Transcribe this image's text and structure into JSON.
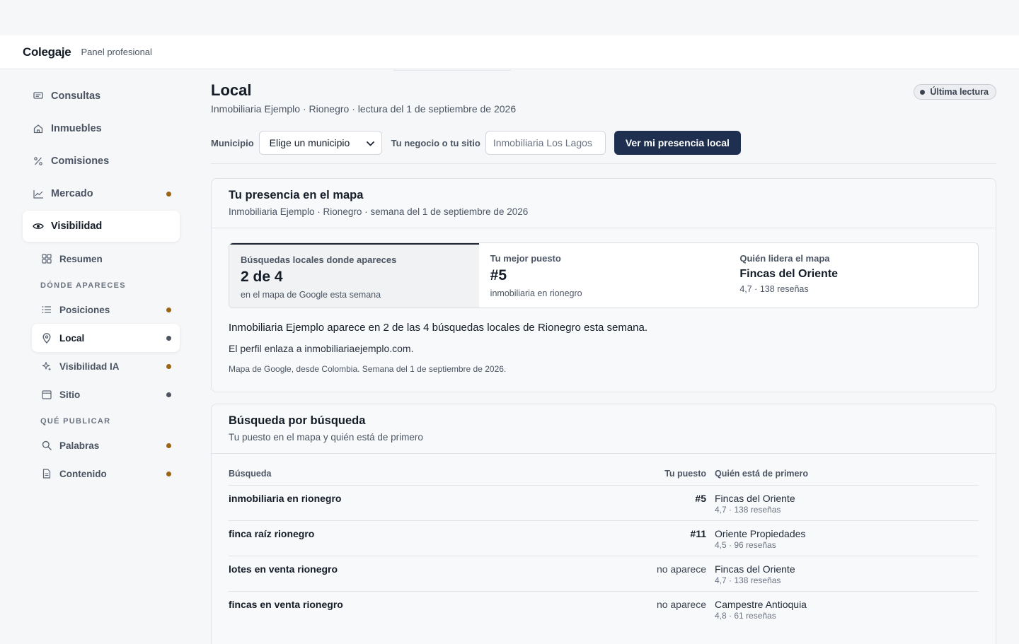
{
  "app": {
    "brand": "Colegaje",
    "subtitle": "Panel profesional"
  },
  "sidebar": {
    "items": [
      {
        "label": "Consultas",
        "icon": "message-icon"
      },
      {
        "label": "Inmuebles",
        "icon": "home-icon"
      },
      {
        "label": "Comisiones",
        "icon": "percent-icon"
      },
      {
        "label": "Mercado",
        "icon": "chart-line-icon",
        "dot": "amber"
      },
      {
        "label": "Visibilidad",
        "icon": "eye-icon",
        "active": true
      }
    ],
    "resumen": "Resumen",
    "section1": "DÓNDE APARECES",
    "section1_items": [
      {
        "label": "Posiciones",
        "dot": "amber"
      },
      {
        "label": "Local",
        "dot": "gray",
        "active": true
      },
      {
        "label": "Visibilidad IA",
        "dot": "amber"
      },
      {
        "label": "Sitio",
        "dot": "gray"
      }
    ],
    "section2": "QUÉ PUBLICAR",
    "section2_items": [
      {
        "label": "Palabras",
        "dot": "amber"
      },
      {
        "label": "Contenido",
        "dot": "amber"
      }
    ]
  },
  "header": {
    "title": "Local",
    "subtitle": "Inmobiliaria Ejemplo · Rionegro · lectura del 1 de septiembre de 2026",
    "badge": "Última lectura"
  },
  "filters": {
    "municipio_label": "Municipio",
    "municipio_value": "Elige un municipio",
    "negocio_label": "Tu negocio o tu sitio",
    "negocio_placeholder": "Inmobiliaria Los Lagos",
    "submit": "Ver mi presencia local"
  },
  "presence": {
    "title": "Tu presencia en el mapa",
    "subtitle": "Inmobiliaria Ejemplo · Rionegro · semana del 1 de septiembre de 2026",
    "stats": [
      {
        "label": "Búsquedas locales donde apareces",
        "value": "2 de 4",
        "note": "en el mapa de Google esta semana"
      },
      {
        "label": "Tu mejor puesto",
        "value": "#5",
        "note": "inmobiliaria en rionegro"
      },
      {
        "label": "Quién lidera el mapa",
        "value": "Fincas del Oriente",
        "note": "4,7 · 138 reseñas"
      }
    ],
    "summary": "Inmobiliaria Ejemplo aparece en 2 de las 4 búsquedas locales de Rionegro esta semana.",
    "link_note": "El perfil enlaza a inmobiliariaejemplo.com.",
    "source": "Mapa de Google, desde Colombia. Semana del 1 de septiembre de 2026."
  },
  "searches": {
    "title": "Búsqueda por búsqueda",
    "subtitle": "Tu puesto en el mapa y quién está de primero",
    "columns": [
      "Búsqueda",
      "Tu puesto",
      "Quién está de primero"
    ],
    "rows": [
      {
        "query": "inmobiliaria en rionegro",
        "rank": "#5",
        "leader": "Fincas del Oriente",
        "meta": "4,7 · 138 reseñas"
      },
      {
        "query": "finca raíz rionegro",
        "rank": "#11",
        "leader": "Oriente Propiedades",
        "meta": "4,5 · 96 reseñas"
      },
      {
        "query": "lotes en venta rionegro",
        "rank": "no aparece",
        "leader": "Fincas del Oriente",
        "meta": "4,7 · 138 reseñas"
      },
      {
        "query": "fincas en venta rionegro",
        "rank": "no aparece",
        "leader": "Campestre Antioquia",
        "meta": "4,8 · 61 reseñas"
      }
    ]
  }
}
